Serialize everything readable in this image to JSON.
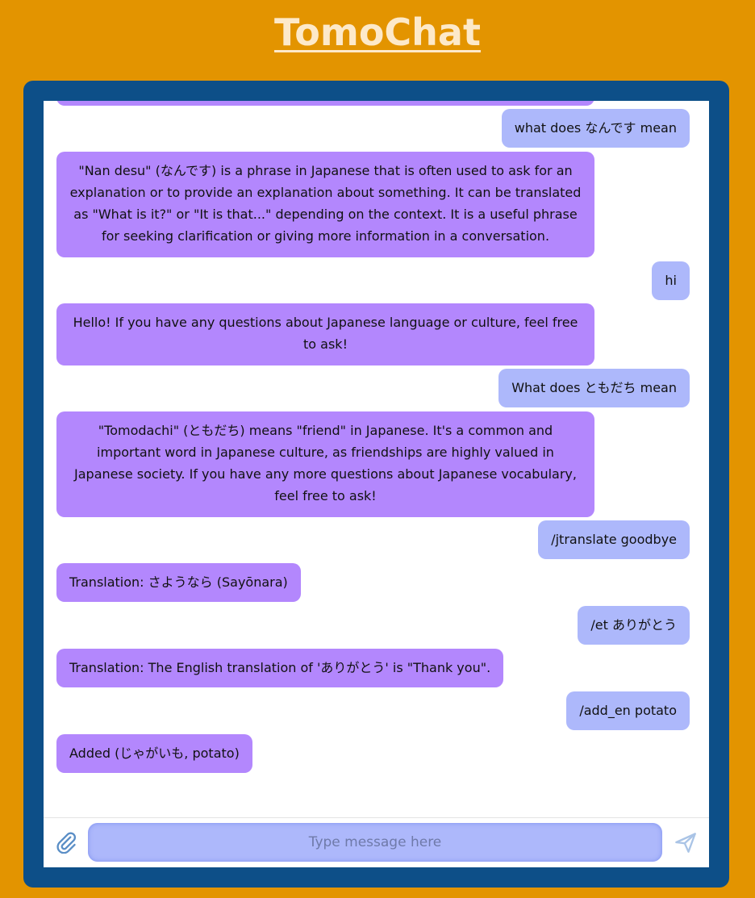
{
  "app": {
    "title": "TomoChat"
  },
  "colors": {
    "background": "#e39400",
    "frame": "#0d4f88",
    "bot_bubble": "#b387fd",
    "user_bubble": "#adb8fb",
    "title": "#fde9c9"
  },
  "messages": [
    {
      "role": "user",
      "text": "what does なんです mean"
    },
    {
      "role": "bot",
      "text": "\"Nan desu\" (なんです) is a phrase in Japanese that is often used to ask for an explanation or to provide an explanation about something. It can be translated as \"What is it?\" or \"It is that...\" depending on the context. It is a useful phrase for seeking clarification or giving more information in a conversation."
    },
    {
      "role": "user",
      "text": "hi"
    },
    {
      "role": "bot",
      "text": "Hello! If you have any questions about Japanese language or culture, feel free to ask!"
    },
    {
      "role": "user",
      "text": "What does ともだち mean"
    },
    {
      "role": "bot",
      "text": "\"Tomodachi\" (ともだち) means \"friend\" in Japanese. It's a common and important word in Japanese culture, as friendships are highly valued in Japanese society. If you have any more questions about Japanese vocabulary, feel free to ask!"
    },
    {
      "role": "user",
      "text": "/jtranslate goodbye"
    },
    {
      "role": "bot",
      "text": "Translation: さようなら (Sayōnara)"
    },
    {
      "role": "user",
      "text": "/et ありがとう"
    },
    {
      "role": "bot",
      "text": "Translation: The English translation of 'ありがとう' is \"Thank you\"."
    },
    {
      "role": "user",
      "text": "/add_en potato"
    },
    {
      "role": "bot",
      "text": "Added (じゃがいも, potato)"
    }
  ],
  "composer": {
    "placeholder": "Type message here",
    "value": "",
    "attach_icon": "paperclip-icon",
    "send_icon": "send-icon"
  }
}
